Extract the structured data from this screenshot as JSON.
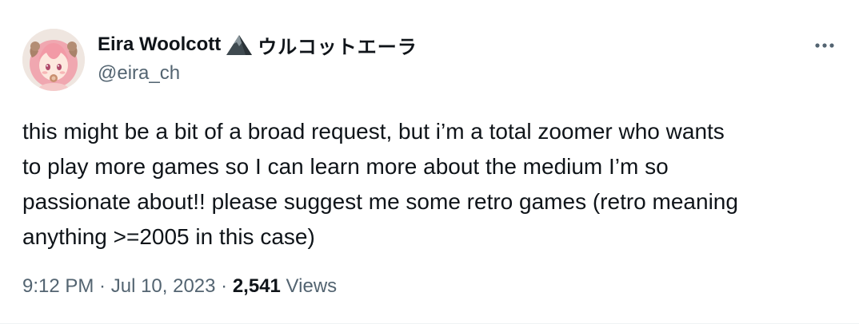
{
  "author": {
    "display_name": "Eira Woolcott",
    "emoji_icon": "mountain-icon",
    "name_suffix": "ウルコットエーラ",
    "handle": "@eira_ch",
    "avatar": "anime-avatar-pink-hair"
  },
  "more_menu": {
    "icon": "more-horizontal-icon"
  },
  "tweet": {
    "text": "this might be a bit of a broad request, but i’m a total zoomer who wants\nto play more games so I can learn more about the medium I’m so\npassionate about!! please suggest me some retro games (retro meaning\nanything >=2005 in this case)"
  },
  "meta": {
    "time": "9:12 PM",
    "sep1": " · ",
    "date": "Jul 10, 2023",
    "sep2": " · ",
    "views_count": "2,541",
    "views_label": " Views"
  },
  "colors": {
    "primary_text": "#0f1419",
    "secondary_text": "#536471",
    "background": "#ffffff"
  }
}
